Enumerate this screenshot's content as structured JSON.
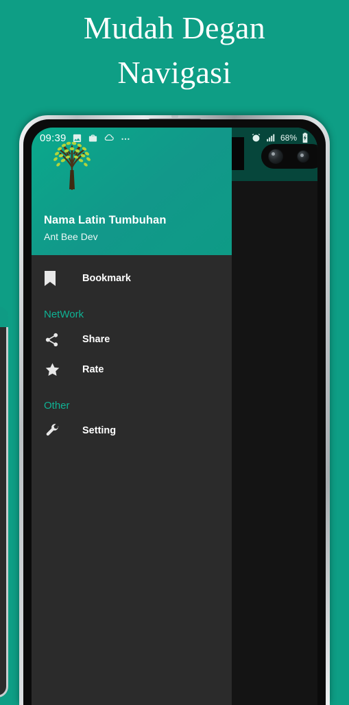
{
  "promo": {
    "headline": "Mudah Degan\nNavigasi"
  },
  "colors": {
    "background_teal": "#0e9e85",
    "appbar_teal": "#0f9b84",
    "drawer_dark": "#2b2b2b",
    "scrim_dark": "#141414",
    "section_accent": "#0fb395",
    "text_white": "#ffffff"
  },
  "status_bar": {
    "time": "09:39",
    "left_icons": [
      "image-icon",
      "briefcase-icon",
      "cloud-icon",
      "more-dots-icon"
    ],
    "right_icons": [
      "alarm-icon",
      "signal-icon",
      "battery-charging-icon"
    ],
    "battery_percent": "68%"
  },
  "app_bar": {
    "action_icon": "bookmark-icon"
  },
  "drawer": {
    "logo_icon": "tree-logo-icon",
    "title": "Nama Latin Tumbuhan",
    "subtitle": "Ant Bee Dev",
    "groups": [
      {
        "header": null,
        "items": [
          {
            "icon": "bookmark-icon",
            "label": "Bookmark"
          }
        ]
      },
      {
        "header": "NetWork",
        "items": [
          {
            "icon": "share-icon",
            "label": "Share"
          },
          {
            "icon": "star-icon",
            "label": "Rate"
          }
        ]
      },
      {
        "header": "Other",
        "items": [
          {
            "icon": "wrench-icon",
            "label": "Setting"
          }
        ]
      }
    ]
  }
}
